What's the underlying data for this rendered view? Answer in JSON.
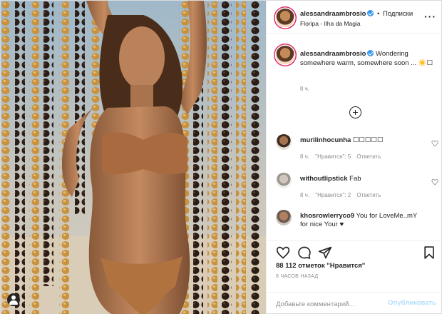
{
  "header": {
    "username": "alessandraambrosio",
    "separator": "•",
    "follow_label": "Подписки",
    "location": "Floripa - Ilha da Magia",
    "more_icon": "more-horizontal-icon"
  },
  "caption": {
    "username": "alessandraambrosio",
    "text": "Wondering somewhere warm, somewhere soon ... ☀️☐",
    "time": "8 ч."
  },
  "load_more_icon": "add-circle-icon",
  "comments": [
    {
      "username": "murilinhocunha",
      "text": "☐☐☐☐☐",
      "time": "8 ч.",
      "likes": "\"Нравится\": 5",
      "reply": "Ответить"
    },
    {
      "username": "withoutlipstick",
      "text": "Fab",
      "time": "8 ч.",
      "likes": "\"Нравится\": 2",
      "reply": "Ответить"
    },
    {
      "username": "khosrowlerryco9",
      "text": "You for LoveMe..mY for nice Your ♥",
      "time": "",
      "likes": "",
      "reply": ""
    }
  ],
  "actions": {
    "icons": [
      "heart-icon",
      "comment-icon",
      "share-icon",
      "save-icon"
    ],
    "likes": "88 112 отметок \"Нравится\"",
    "ago": "8 ЧАСОВ НАЗАД"
  },
  "comment_form": {
    "placeholder": "Добавьте комментарий...",
    "publish_label": "Опубликовать"
  },
  "colors": {
    "accent": "#3897f0",
    "publish_disabled": "#b2dffc",
    "muted": "#8e8e8e",
    "text": "#262626"
  }
}
